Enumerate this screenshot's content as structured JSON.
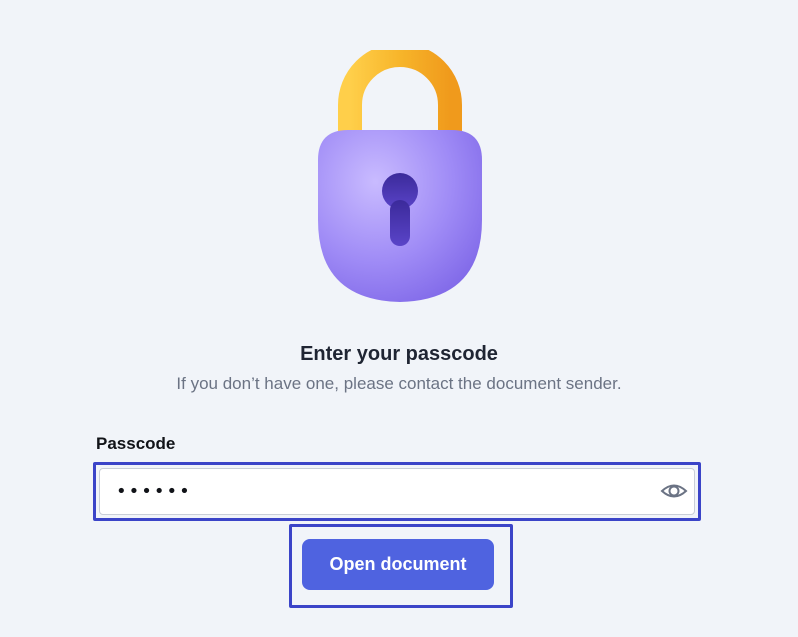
{
  "auth": {
    "title": "Enter your passcode",
    "subtitle": "If you don’t have one, please contact the document sender.",
    "field_label": "Passcode",
    "passcode_value": "••••••",
    "open_button_label": "Open document"
  },
  "icons": {
    "lock": "lock-icon",
    "toggle_visibility": "eye-icon"
  },
  "colors": {
    "background": "#f1f4f9",
    "primary_button": "#4f63e0",
    "highlight_border": "#3b44c8",
    "lock_body": "#9b87f5",
    "lock_shackle": "#f5b82e"
  }
}
